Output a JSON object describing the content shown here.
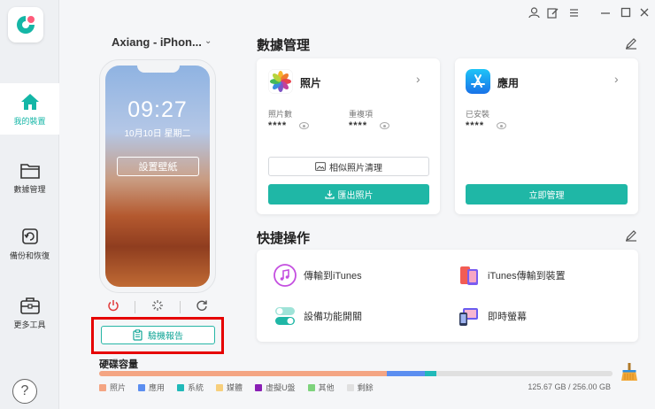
{
  "sidebar": {
    "items": [
      {
        "label": "我的裝置",
        "icon": "home-icon"
      },
      {
        "label": "數據管理",
        "icon": "folder-icon"
      },
      {
        "label": "備份和恢復",
        "icon": "backup-icon"
      },
      {
        "label": "更多工具",
        "icon": "toolbox-icon"
      }
    ],
    "help": "?"
  },
  "device": {
    "name": "Axiang - iPhon...",
    "caret": "⌄",
    "time": "09:27",
    "date": "10月10日 星期二",
    "set_wallpaper": "設置壁紙",
    "report_button": "驗機報告"
  },
  "data_mgmt": {
    "title": "數據管理",
    "photos": {
      "title": "照片",
      "stat1_label": "照片數",
      "stat1_value": "****",
      "stat2_label": "重複項",
      "stat2_value": "****",
      "clean_button": "相似照片清理",
      "export_button": "匯出照片"
    },
    "apps": {
      "title": "應用",
      "stat_label": "已安裝",
      "stat_value": "****",
      "manage_button": "立即管理"
    }
  },
  "quick": {
    "title": "快捷操作",
    "items": [
      {
        "label": "傳輸到iTunes",
        "icon": "itunes-icon"
      },
      {
        "label": "iTunes傳輸到裝置",
        "icon": "iphone-icon"
      },
      {
        "label": "設備功能開關",
        "icon": "toggle-icon"
      },
      {
        "label": "即時螢幕",
        "icon": "screen-mirror-icon"
      }
    ]
  },
  "storage": {
    "title": "硬碟容量",
    "capacity": "125.67 GB / 256.00 GB",
    "segments": [
      {
        "label": "照片",
        "color": "#f4a583",
        "fraction": 0.56
      },
      {
        "label": "應用",
        "color": "#5b8ef0",
        "fraction": 0.075
      },
      {
        "label": "系統",
        "color": "#21b9b9",
        "fraction": 0.022
      },
      {
        "label": "媒體",
        "color": "#f7cf7c",
        "fraction": 0
      },
      {
        "label": "虛擬U盤",
        "color": "#8a1fb5",
        "fraction": 0
      },
      {
        "label": "其他",
        "color": "#7ed37c",
        "fraction": 0
      },
      {
        "label": "剩餘",
        "color": "#e0e0e0",
        "fraction": 0.343
      }
    ]
  },
  "colors": {
    "accent": "#1fb7a6",
    "highlight": "#e60000"
  }
}
